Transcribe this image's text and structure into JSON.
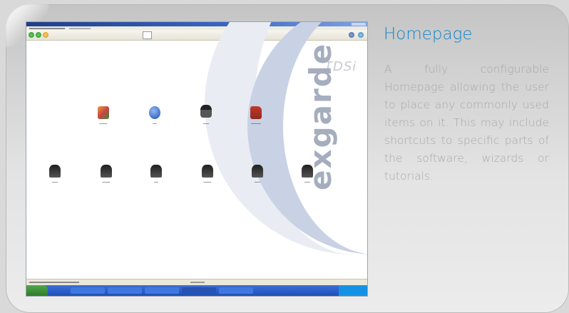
{
  "card": {
    "heading": "Homepage",
    "description": "A fully configurable Homepage allowing the user to place any commonly used items on it. This may include shortcuts to specific parts of the software, wizards or tutorials.",
    "accent": "#1386c8"
  },
  "screenshot": {
    "brand_logo": "TDSi",
    "brand_vertical": "exgarde",
    "top_row_icons": [
      "cube-icon",
      "info-icon",
      "user-icon",
      "book-icon"
    ],
    "bottom_row_icons": [
      "person-icon",
      "person-icon",
      "person-icon",
      "person-icon",
      "person-icon",
      "person-icon"
    ]
  }
}
